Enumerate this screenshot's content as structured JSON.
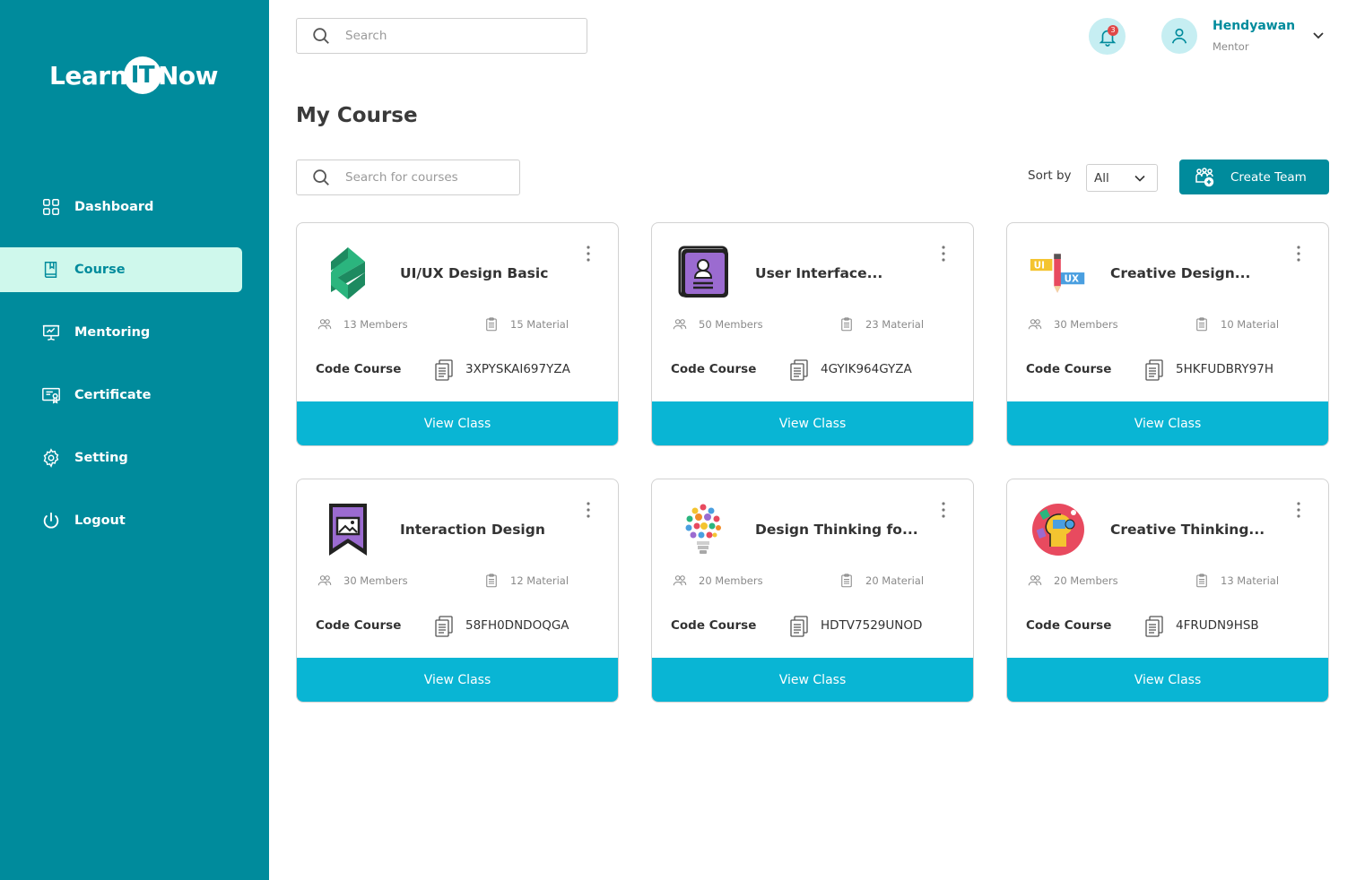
{
  "brand": {
    "pre": "Learn",
    "mid": "IT",
    "post": "Now",
    "primary_color": "#008b9c",
    "accent_color": "#09b5d4",
    "active_bg": "#cff8ec"
  },
  "sidebar": {
    "items": [
      {
        "label": "Dashboard",
        "icon": "grid-icon"
      },
      {
        "label": "Course",
        "icon": "book-icon",
        "active": true
      },
      {
        "label": "Mentoring",
        "icon": "presentation-icon"
      },
      {
        "label": "Certificate",
        "icon": "certificate-icon"
      },
      {
        "label": "Setting",
        "icon": "gear-icon"
      },
      {
        "label": "Logout",
        "icon": "power-icon"
      }
    ]
  },
  "header": {
    "search_placeholder": "Search",
    "notifications_count": "3",
    "user_name": "Hendyawan",
    "user_role": "Mentor"
  },
  "main": {
    "title": "My Course",
    "course_search_placeholder": "Search for courses",
    "sort_label": "Sort by",
    "sort_value": "All",
    "create_team_label": "Create Team"
  },
  "courses": [
    {
      "title": "UI/UX Design Basic",
      "members": "13 Members",
      "material": "15 Material",
      "code_label": "Code Course",
      "code": "3XPYSKAI697YZA",
      "button": "View Class",
      "thumb": "green-ribbon-logo"
    },
    {
      "title": "User Interface...",
      "members": "50 Members",
      "material": "23 Material",
      "code_label": "Code Course",
      "code": "4GYIK964GYZA",
      "button": "View Class",
      "thumb": "purple-id-card-icon"
    },
    {
      "title": "Creative Design...",
      "members": "30 Members",
      "material": "10 Material",
      "code_label": "Code Course",
      "code": "5HKFUDBRY97H",
      "button": "View Class",
      "thumb": "ui-ux-pencil-icon"
    },
    {
      "title": "Interaction Design",
      "members": "30 Members",
      "material": "12 Material",
      "code_label": "Code Course",
      "code": "58FH0DNDOQGA",
      "button": "View Class",
      "thumb": "purple-bookmark-icon"
    },
    {
      "title": "Design Thinking fo...",
      "members": "20 Members",
      "material": "20 Material",
      "code_label": "Code Course",
      "code": "HDTV7529UNOD",
      "button": "View Class",
      "thumb": "lightbulb-gears-icon"
    },
    {
      "title": "Creative Thinking...",
      "members": "20 Members",
      "material": "13 Material",
      "code_label": "Code Course",
      "code": "4FRUDN9HSB",
      "button": "View Class",
      "thumb": "creative-head-icon"
    }
  ]
}
